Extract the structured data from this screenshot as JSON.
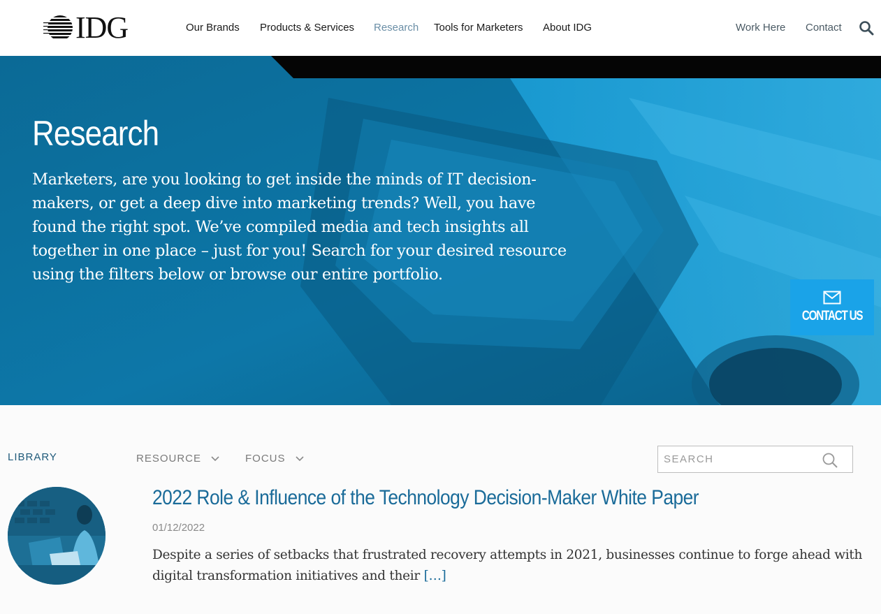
{
  "header": {
    "logo_text": "IDG",
    "nav": [
      {
        "label": "Our Brands",
        "active": false
      },
      {
        "label": "Products & Services",
        "active": false
      },
      {
        "label": "Research",
        "active": true
      },
      {
        "label": "Tools for Marketers",
        "active": false
      },
      {
        "label": "About IDG",
        "active": false
      }
    ],
    "nav_right": [
      {
        "label": "Work Here"
      },
      {
        "label": "Contact"
      }
    ],
    "search_icon": "search-icon"
  },
  "hero": {
    "title": "Research",
    "text": "Marketers, are you looking to get inside the minds of IT decision-makers, or get a deep dive into marketing trends? Well, you have found the right spot. We’ve compiled media and tech insights all together in one place – just for you! Search for your desired resource using the filters below or browse our entire portfolio.",
    "contact_us_label": "CONTACT US",
    "contact_icon": "envelope-icon"
  },
  "filters": {
    "library_label": "LIBRARY",
    "resource_label": "RESOURCE",
    "focus_label": "FOCUS",
    "search_placeholder": "SEARCH"
  },
  "articles": [
    {
      "title": "2022 Role & Influence of the Technology Decision-Maker White Paper",
      "date": "01/12/2022",
      "excerpt": "Despite a series of setbacks that frustrated recovery attempts in 2021, businesses continue to forge ahead with digital transformation initiatives and their",
      "more": "[…]"
    }
  ],
  "colors": {
    "brand_blue": "#1a6b99",
    "accent_blue": "#1aa3e8",
    "hero_blue": "#0f6e98",
    "active_nav": "#6a8ea6"
  }
}
